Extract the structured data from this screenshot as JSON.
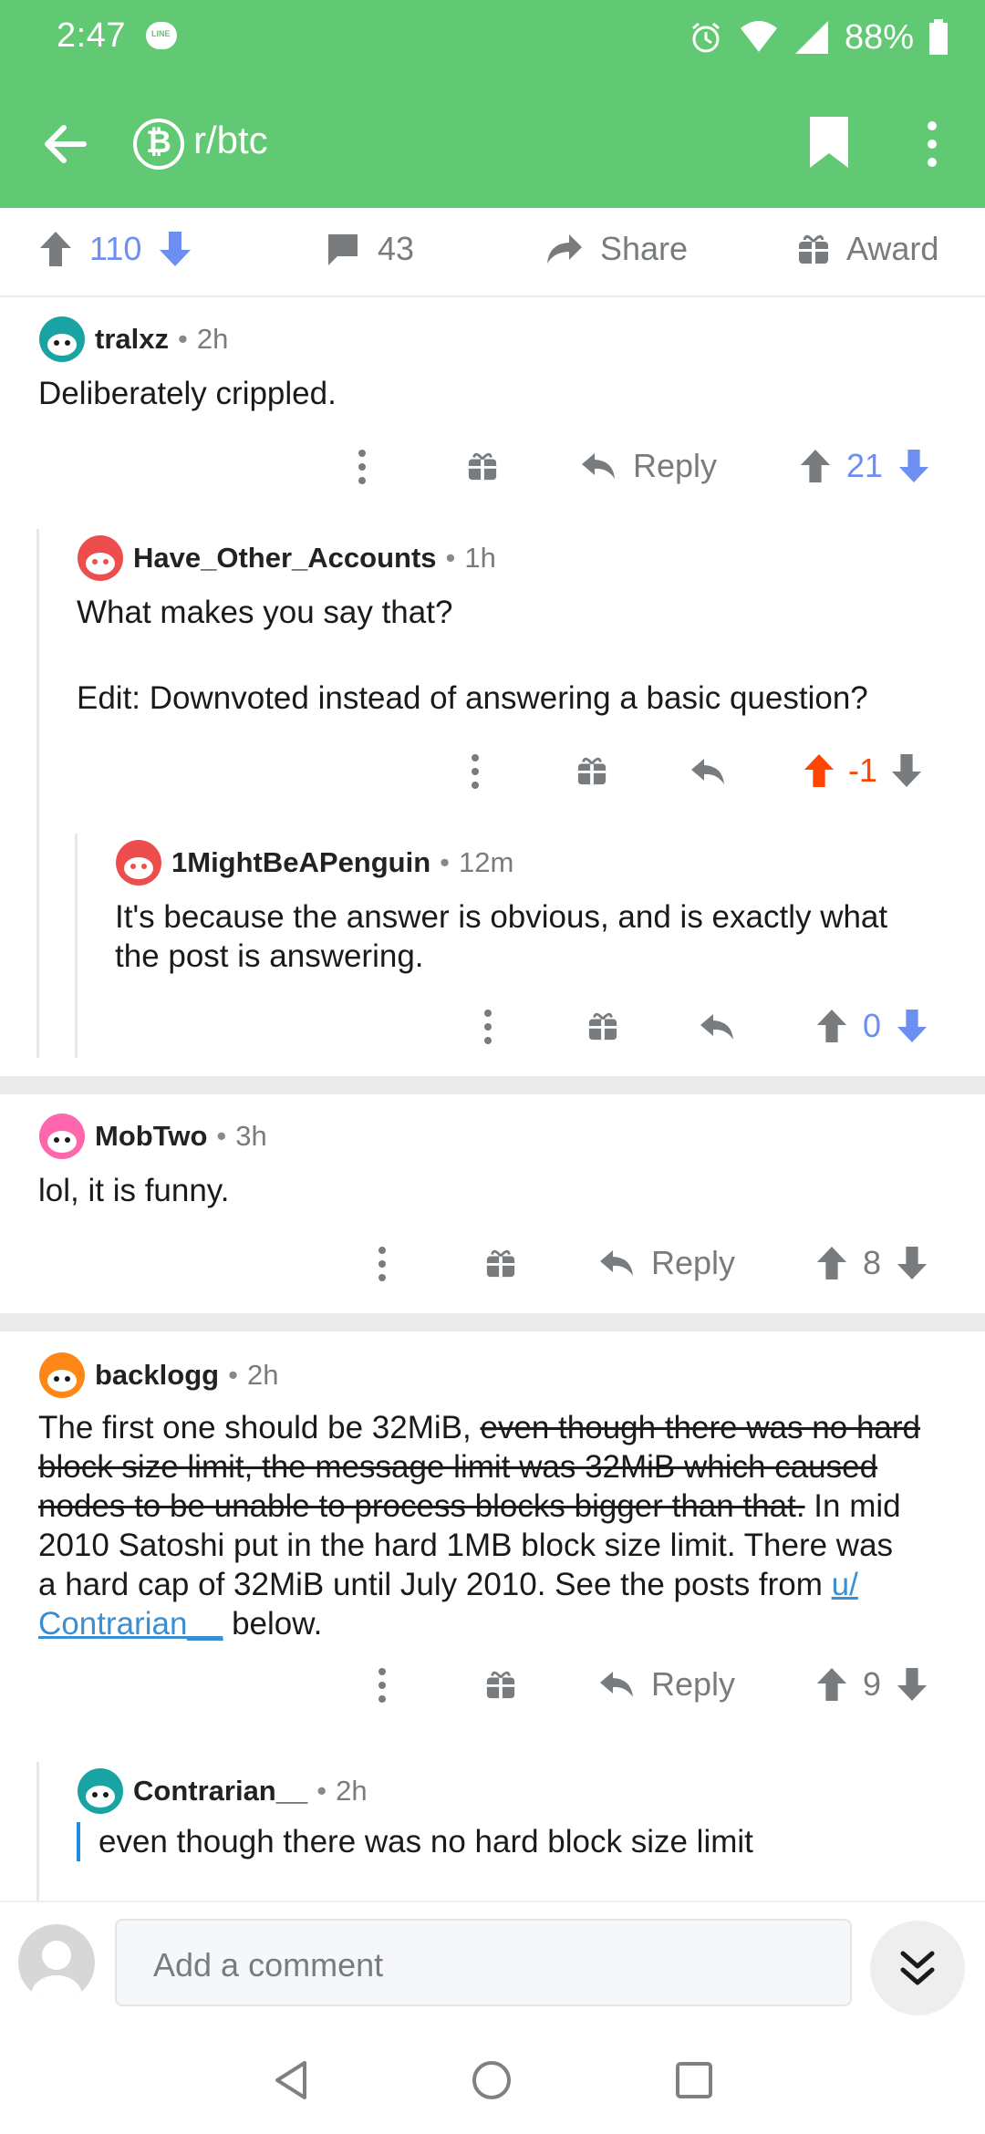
{
  "status_bar": {
    "time": "2:47",
    "battery": "88%",
    "notification_icon": "line-app-icon",
    "icons": [
      "alarm-icon",
      "wifi-icon",
      "signal-icon",
      "battery-icon"
    ]
  },
  "app_bar": {
    "subreddit": "r/btc",
    "subreddit_icon_glyph": "₿",
    "accent_color": "#61c873"
  },
  "post_actions": {
    "score": "110",
    "comments": "43",
    "share_label": "Share",
    "award_label": "Award"
  },
  "comments": [
    {
      "author": "tralxz",
      "age": "2h",
      "body": "Deliberately crippled.",
      "reply_label": "Reply",
      "score": "21"
    },
    {
      "author": "Have_Other_Accounts",
      "age": "1h",
      "body_line1": "What makes you say that?",
      "body_line2": "Edit: Downvoted instead of answering a basic question?",
      "score": "-1"
    },
    {
      "author": "1MightBeAPenguin",
      "age": "12m",
      "body_line1": "It's because the answer is obvious, and is exactly what",
      "body_line2": "the post is answering.",
      "score": "0"
    },
    {
      "author": "MobTwo",
      "age": "3h",
      "body": "lol, it is funny.",
      "reply_label": "Reply",
      "score": "8"
    },
    {
      "author": "backlogg",
      "age": "2h",
      "body_plain_start": "The first one should be 32MiB, ",
      "body_strike_1": "even though there was no hard",
      "body_strike_2": "block size limit, the message limit was 32MiB which caused",
      "body_strike_3": "nodes to be unable to process blocks bigger than that.",
      "body_after_strike": " In mid",
      "body_line4": "2010 Satoshi put in the hard 1MB block size limit. There was",
      "body_line5": "a hard cap of 32MiB until July 2010. See the posts from ",
      "body_link_1": "u/",
      "body_link_2": "Contrarian__",
      "body_end": " below.",
      "reply_label": "Reply",
      "score": "9"
    },
    {
      "author": "Contrarian__",
      "age": "2h",
      "quote": "even though there was no hard block size limit"
    }
  ],
  "composer": {
    "placeholder": "Add a comment"
  },
  "separator_dot": "•"
}
